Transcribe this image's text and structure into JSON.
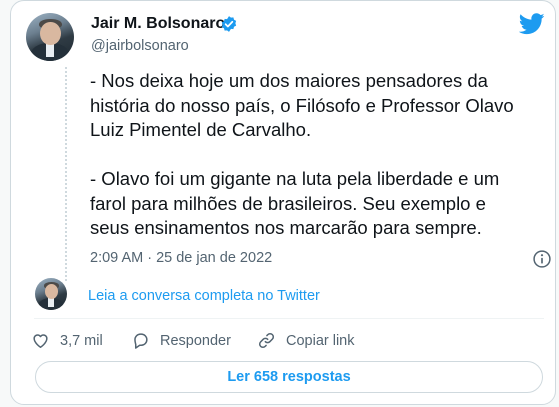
{
  "tweet": {
    "author_name": "Jair M. Bolsonaro",
    "author_handle": "@jairbolsonaro",
    "paragraphs": [
      "- Nos deixa hoje um dos maiores pensadores da história do nosso país, o Filósofo e Professor Olavo Luiz Pimentel de Carvalho.",
      "- Olavo foi um gigante na luta pela liberdade e um farol para milhões de brasileiros. Seu exemplo e seus ensinamentos nos marcarão para sempre."
    ],
    "timestamp": "2:09 AM · 25 de jan de 2022"
  },
  "thread": {
    "link_text": "Leia a conversa completa no Twitter"
  },
  "actions": {
    "likes": "3,7 mil",
    "reply_label": "Responder",
    "copy_link_label": "Copiar link"
  },
  "replies_button": "Ler 658 respostas",
  "icons": {
    "verified": "verified-badge-icon",
    "brand": "twitter-bird-icon",
    "info": "info-icon",
    "like": "heart-icon",
    "reply": "reply-bubble-icon",
    "copy": "link-icon"
  },
  "colors": {
    "accent": "#1d9bf0",
    "text": "#0f1419",
    "muted": "#536471",
    "border": "#cfd9de"
  }
}
